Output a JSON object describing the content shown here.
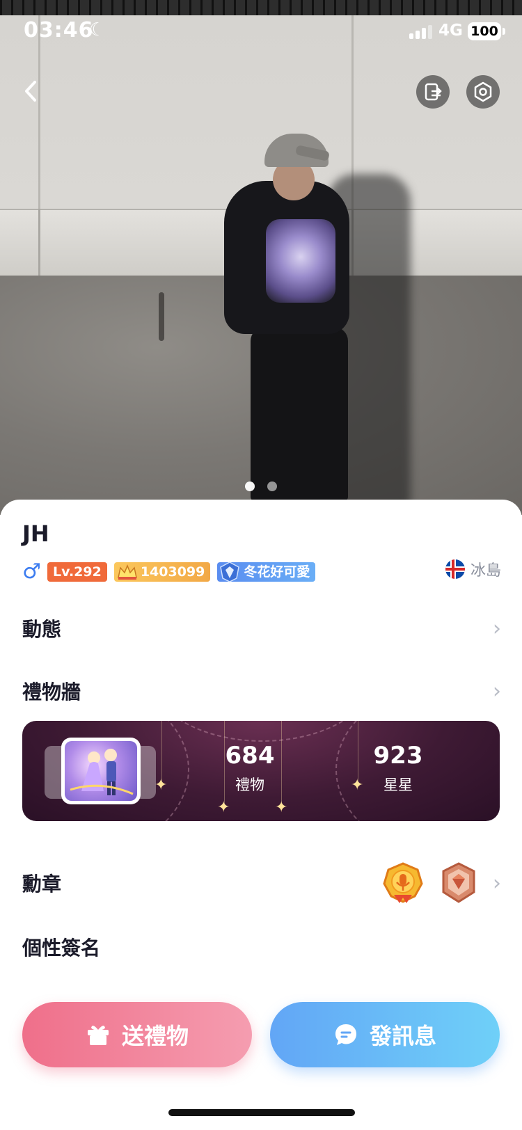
{
  "status_bar": {
    "time": "03:46",
    "network": "4G",
    "battery": "100"
  },
  "profile": {
    "name": "JH",
    "gender_symbol": "♂",
    "level": "Lv.292",
    "wealth": "1403099",
    "guild": "冬花好可愛",
    "region": "冰島"
  },
  "sections": {
    "moments": "動態",
    "gift_wall": "禮物牆",
    "medals": "勳章",
    "signature": "個性簽名"
  },
  "gift_wall": {
    "gift_count": "684",
    "gift_label": "禮物",
    "star_count": "923",
    "star_label": "星星"
  },
  "actions": {
    "send_gift": "送禮物",
    "send_message": "發訊息"
  },
  "colors": {
    "level_tag": "#f06a3a",
    "wealth_tag": "#f2a846",
    "guild_tag": "#5a8df0",
    "gift_button": "#ef6f8a",
    "message_button": "#62a6f6"
  },
  "icons": {
    "back": "chevron-left-icon",
    "switch": "switch-account-icon",
    "settings": "hexagon-settings-icon",
    "moon": "moon-icon"
  }
}
